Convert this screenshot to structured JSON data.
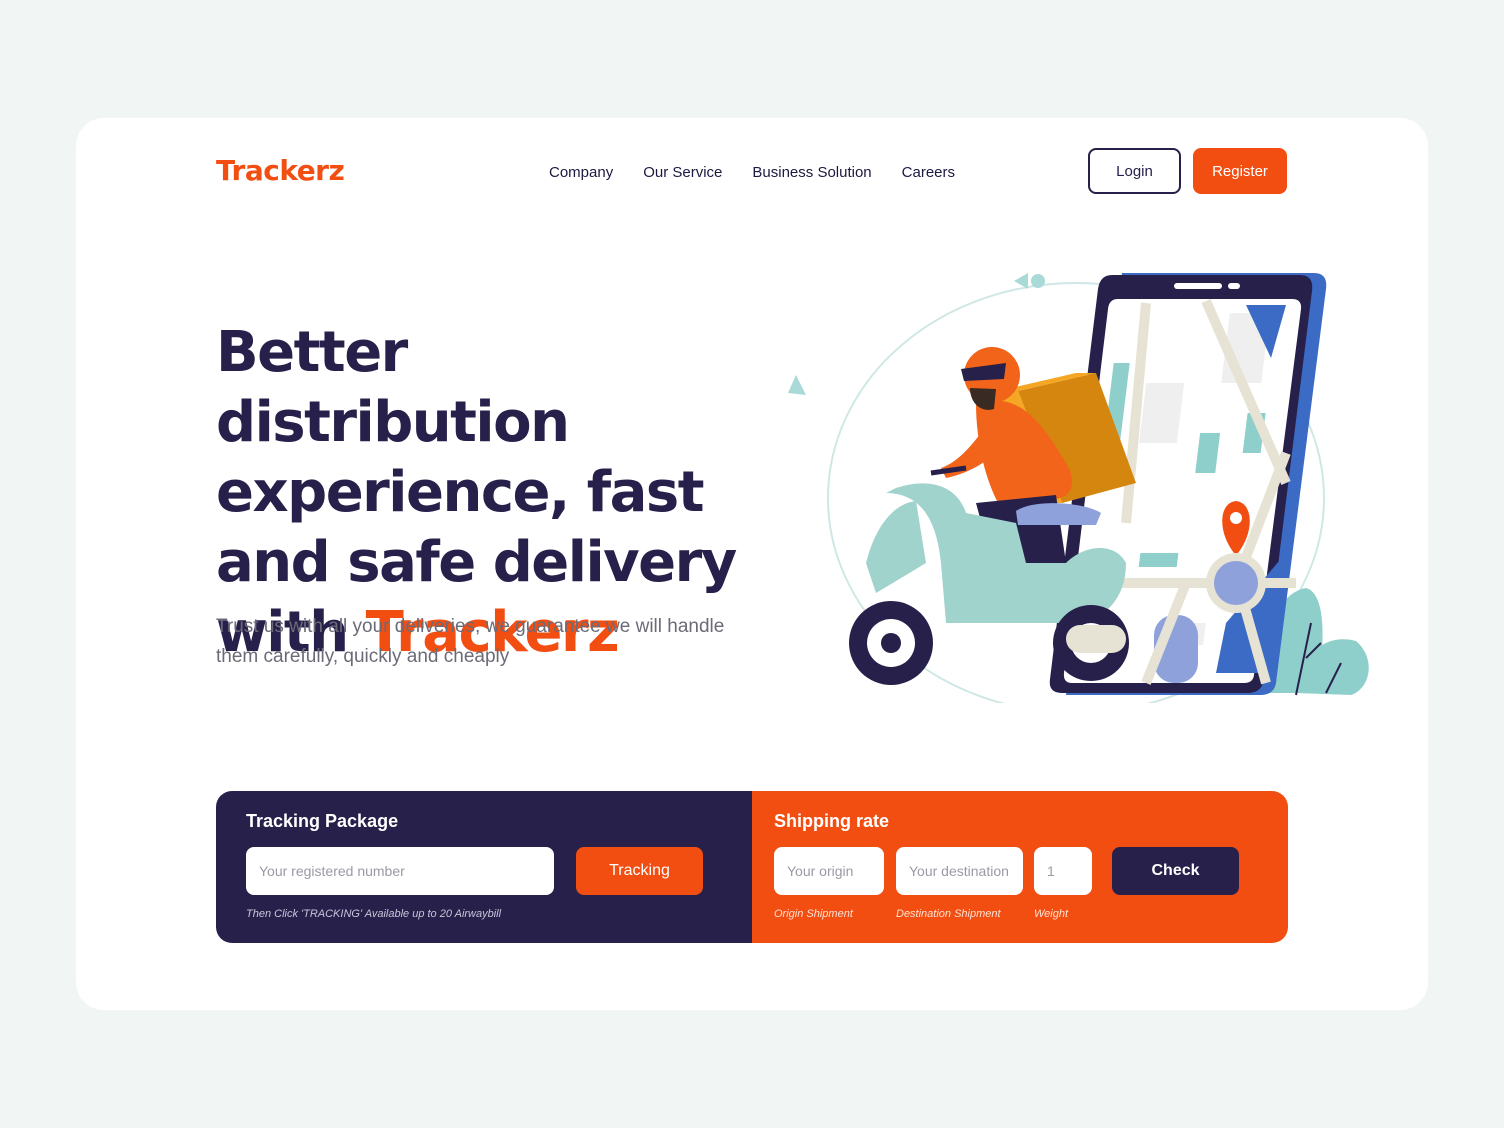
{
  "brand": {
    "name": "Trackerz"
  },
  "nav": {
    "items": [
      {
        "label": "Company"
      },
      {
        "label": "Our Service"
      },
      {
        "label": "Business Solution"
      },
      {
        "label": "Careers"
      }
    ]
  },
  "auth": {
    "login_label": "Login",
    "register_label": "Register"
  },
  "hero": {
    "title_line1": "Better distribution",
    "title_line2": "experience, fast",
    "title_line3": "and safe delivery",
    "title_line4_prefix": "with",
    "title_accent": "Trackerz",
    "subtitle": "Trust us with all your deliveries, we guarantee we will handle them carefully, quickly and cheaply",
    "illustration_icon": "delivery-scooter-phone-map-illustration"
  },
  "tracking": {
    "title": "Tracking Package",
    "input_placeholder": "Your registered number",
    "button_label": "Tracking",
    "hint": "Then Click 'TRACKING' Available up to 20 Airwaybill"
  },
  "shipping": {
    "title": "Shipping rate",
    "origin_placeholder": "Your origin",
    "origin_caption": "Origin Shipment",
    "destination_placeholder": "Your destination",
    "destination_caption": "Destination Shipment",
    "weight_placeholder": "1",
    "weight_caption": "Weight",
    "button_label": "Check"
  },
  "colors": {
    "accent": "#f24e12",
    "navy": "#27204b",
    "background": "#f1f6f5",
    "teal": "#8fcfcb",
    "blue": "#3b6bc4"
  }
}
